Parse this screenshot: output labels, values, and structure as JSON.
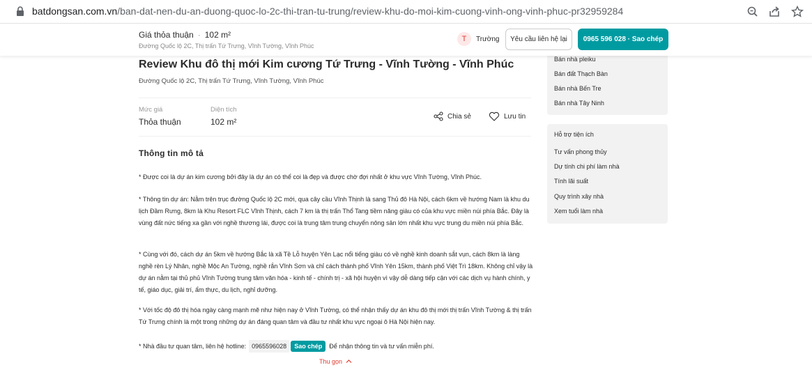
{
  "browser": {
    "url_host": "batdongsan.com.vn",
    "url_path": "/ban-dat-nen-du-an-duong-quoc-lo-2c-thi-tran-tu-trung/review-khu-do-moi-kim-cuong-vinh-ong-vinh-phuc-pr32959284"
  },
  "sticky": {
    "price": "Giá thỏa thuận",
    "area": "102 m²",
    "address": "Đường Quốc lộ 2C, Thị trấn Tứ Trưng, Vĩnh Tường, Vĩnh Phúc",
    "agent_initial": "T",
    "agent_name": "Trường",
    "contact_label": "Yêu cầu liên hệ lại",
    "phone_label": "0965 596 028 · Sao chép"
  },
  "listing": {
    "title": "Review Khu đô thị mới Kim cương Tứ Trưng - Vĩnh Tường - Vĩnh Phúc",
    "address": "Đường Quốc lộ 2C, Thị trấn Tứ Trưng, Vĩnh Tường, Vĩnh Phúc",
    "price_label": "Mức giá",
    "price_value": "Thỏa thuận",
    "area_label": "Diện tích",
    "area_value": "102 m²",
    "share_label": "Chia sẻ",
    "save_label": "Lưu tin"
  },
  "description": {
    "heading": "Thông tin mô tả",
    "paragraphs": [
      "* Được coi là dự án kim cương bởi đây là dự án có thể coi là đẹp và được chờ đợi nhất ở khu vực Vĩnh Tường, Vĩnh Phúc.",
      "* Thông tin dự án: Nằm trên trục đường Quốc lộ 2C mới, qua cây cầu Vĩnh Thịnh là sang Thủ đô Hà Nội, cách 6km về hướng Nam là khu du lịch Đầm Rưng, 8km là Khu Resort FLC Vĩnh Thịnh, cách 7 km là thị trấn Thổ Tang tiềm năng giàu có của khu vực miền núi phía Bắc. Đây là vùng đất nức tiếng xa gần với nghề thương lái, được coi là trung tâm trung chuyển nông sản lớn nhất khu vực trung du miền núi phía Bắc.",
      "* Cùng với đó, cách dự án 5km về hướng Bắc là xã Tề Lỗ huyện Yên Lạc nổi tiếng giàu có về nghề kinh doanh sắt vụn, cách 8km là làng nghề rèn Lý Nhân, nghề Mộc An Tường, nghề rắn Vĩnh Sơn và chỉ cách thành phố Vĩnh Yên 15km, thành phố Việt Trì 18km. Không chỉ vậy là dự án nằm tại thủ phủ Vĩnh Tường trung tâm văn hóa - kinh tế - chính trị - xã hội huyện vì vậy dễ dàng tiếp cận với các dịch vụ hành chính, y tế, giáo dục, giải trí, ẩm thực, du lịch, nghỉ dưỡng.",
      "* Với tốc độ đô thị hóa ngày càng mạnh mẽ như hiện nay ở Vĩnh Tường, có thể nhận thấy dự án khu đô thị mới thị trấn Vĩnh Tường & thị trấn Tứ Trưng chính là một trong những dự án đáng quan tâm và đầu tư nhất khu vực ngoại ô Hà Nội hiện nay."
    ],
    "hotline_prefix": "* Nhà đầu tư quan tâm, liên hệ hotline:",
    "hotline_number": "0965596028",
    "copy_label": "Sao chép",
    "hotline_suffix": "Để nhận thông tin và tư vấn miễn phí.",
    "collapse_label": "Thu gọn"
  },
  "sidebar": {
    "links": [
      "Bán nhà pleiku",
      "Bán đất Thạch Bàn",
      "Bán nhà Bến Tre",
      "Bán nhà Tây Ninh"
    ],
    "utilities_heading": "Hỗ trợ tiện ích",
    "utilities": [
      "Tư vấn phong thủy",
      "Dự tính chi phí làm nhà",
      "Tính lãi suất",
      "Quy trình xây nhà",
      "Xem tuổi làm nhà"
    ]
  },
  "colors": {
    "accent": "#009ba1",
    "red": "#e03c31"
  }
}
